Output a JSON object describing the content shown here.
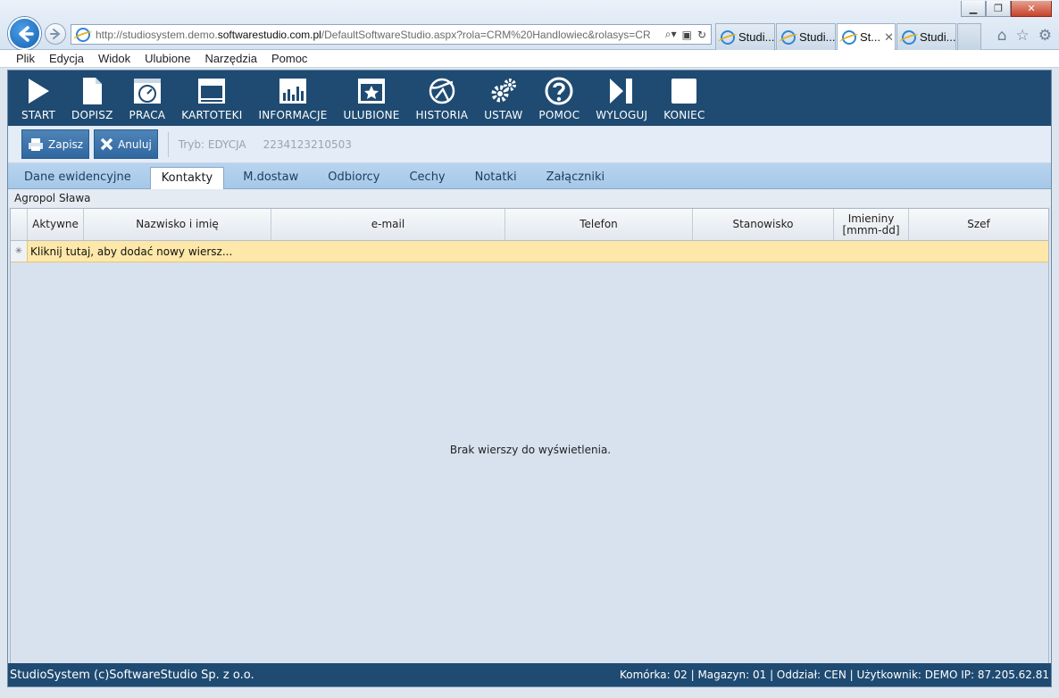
{
  "browser": {
    "url_prefix": "http://studiosystem.demo.",
    "url_domain": "softwarestudio.com.pl",
    "url_rest": "/DefaultSoftwareStudio.aspx?rola=CRM%20Handlowiec&rolasys=CR",
    "tabs": [
      {
        "label": "Studi..."
      },
      {
        "label": "Studi..."
      },
      {
        "label": "St..."
      },
      {
        "label": "Studi..."
      }
    ],
    "menu": [
      "Plik",
      "Edycja",
      "Widok",
      "Ulubione",
      "Narzędzia",
      "Pomoc"
    ]
  },
  "toolbar": {
    "items": [
      {
        "label": "START",
        "icon": "play-icon"
      },
      {
        "label": "DOPISZ",
        "icon": "document-icon"
      },
      {
        "label": "PRACA",
        "icon": "gauge-icon"
      },
      {
        "label": "KARTOTEKI",
        "icon": "window-icon"
      },
      {
        "label": "INFORMACJE",
        "icon": "bar-chart-icon"
      },
      {
        "label": "ULUBIONE",
        "icon": "star-icon"
      },
      {
        "label": "HISTORIA",
        "icon": "history-icon"
      },
      {
        "label": "USTAW",
        "icon": "gears-icon"
      },
      {
        "label": "POMOC",
        "icon": "help-icon"
      },
      {
        "label": "WYLOGUJ",
        "icon": "logout-icon"
      },
      {
        "label": "KONIEC",
        "icon": "square-icon"
      }
    ]
  },
  "actions": {
    "save_label": "Zapisz",
    "cancel_label": "Anuluj",
    "mode": "Tryb: EDYCJA",
    "record_id": "2234123210503"
  },
  "tabs": [
    "Dane ewidencyjne",
    "Kontakty",
    "M.dostaw",
    "Odbiorcy",
    "Cechy",
    "Notatki",
    "Załączniki"
  ],
  "active_tab": "Kontakty",
  "company_name": "Agropol Sława",
  "grid": {
    "columns": [
      "Aktywne",
      "Nazwisko i imię",
      "e-mail",
      "Telefon",
      "Stanowisko",
      "Imieniny [mmm-dd]",
      "Szef"
    ],
    "new_row_text": "Kliknij tutaj, aby dodać nowy wiersz...",
    "empty_text": "Brak wierszy do wyświetlenia."
  },
  "status": {
    "left": "StudioSystem (c)SoftwareStudio Sp. z o.o.",
    "right": "Komórka: 02 | Magazyn: 01 | Oddział: CEN | Użytkownik: DEMO IP: 87.205.62.81"
  },
  "colors": {
    "toolbar_bg": "#1f4b72",
    "new_row_bg": "#fde8a9",
    "button_blue": "#3a72a9"
  }
}
